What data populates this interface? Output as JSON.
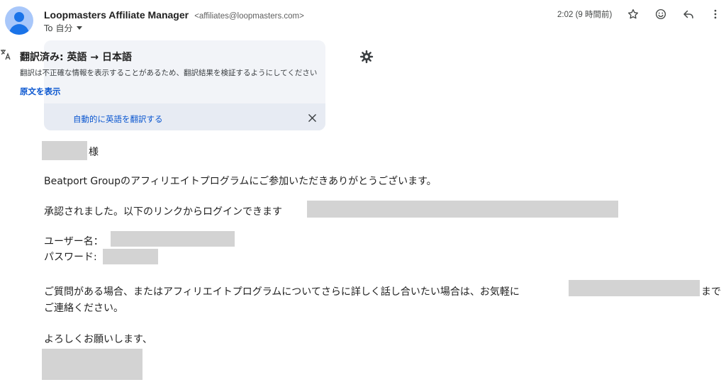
{
  "header": {
    "sender_name": "Loopmasters Affiliate Manager",
    "sender_email": "<affiliates@loopmasters.com>",
    "to_label": "To 自分",
    "time": "2:02 (9 時間前)",
    "icons": [
      "star-icon",
      "emoji-icon",
      "reply-icon",
      "more-vert-icon"
    ]
  },
  "translation": {
    "title": "翻訳済み: 英語 → 日本語",
    "note": "翻訳は不正確な情報を表示することがあるため、翻訳結果を検証するようにしてください",
    "show_original": "原文を表示",
    "auto_translate": "自動的に英語を翻訳する"
  },
  "body": {
    "greeting_suffix": "様",
    "line1": "Beatport Groupのアフィリエイトプログラムにご参加いただきありがとうございます。",
    "line2": "承認されました。以下のリンクからログインできます",
    "username_label": "ユーザー名：",
    "password_label": "パスワード:",
    "line3_prefix": "ご質問がある場合、またはアフィリエイトプログラムについてさらに詳しく話し合いたい場合は、お気軽に",
    "line3_suffix": "まで",
    "line4": "ご連絡ください。",
    "closing": "よろしくお願いします、"
  },
  "colors": {
    "link": "#0b57d0",
    "banner_bg": "#f2f4f8",
    "banner_footer_bg": "#e7ebf3",
    "redaction": "#d3d3d3",
    "avatar_bg": "#a8c7fa",
    "avatar_fg": "#1a73e8"
  }
}
